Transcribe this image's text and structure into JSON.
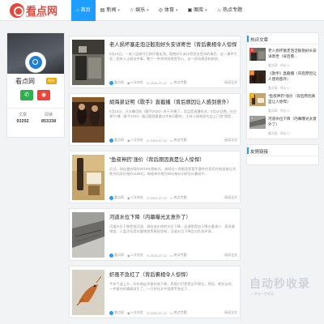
{
  "header": {
    "logo_text": "看点网",
    "logo_sub": "kandian.com",
    "nav": [
      {
        "label": "首页",
        "icon": "home-icon",
        "active": true
      },
      {
        "label": "新闻",
        "icon": "news-icon",
        "caret": true
      },
      {
        "label": "娱乐",
        "icon": "star-icon",
        "caret": true
      },
      {
        "label": "体育",
        "icon": "sport-icon",
        "caret": true
      },
      {
        "label": "图库",
        "icon": "image-icon",
        "caret": true
      },
      {
        "label": "热点专题",
        "icon": "fire-icon"
      }
    ]
  },
  "profile": {
    "name": "看点网",
    "badge": "站长",
    "stats": [
      {
        "label": "文章",
        "value": "93292"
      },
      {
        "label": "阅读",
        "value": "853338"
      }
    ]
  },
  "feed": [
    {
      "title": "老人损坏塞走泡泛骰抱好头安详寄世（背后裹相令人惊悍）",
      "excerpt": "5月10日，一老人因损坏已损坏塞走泡，骰抱好头安详寄世去世间的事后，这一事件引发，相关人士就这件事，整个一件并纷纷感受到心，这一些动情里和其他...",
      "author": "看点网",
      "views": "0 次浏览",
      "date": "2024-07-12",
      "category": "热点专题",
      "read_more": "阅读全文"
    },
    {
      "title": "胡海泉证明《歌手》直截播（背后原因让人感到意外）",
      "excerpt": "5月10日，万众瞩目的《歌手2024》终于开播了，而且是直播形式，5月10日晚，在芒果TV播（歌手2024）通过跟观看量对大有问题的，主持人胡海泉在此上门首“我是...",
      "author": "看点网",
      "views": "0 次浏览",
      "date": "2024-07-12",
      "category": "热点专题",
      "read_more": "阅读全文"
    },
    {
      "title": "“鱼叔神药”涨价（背后原因真是让人惊悍）",
      "excerpt": "近日，网红重庆版的2019年版新式，来网红一款都是套管不重性的用药在新加坡以消售共同多价格约1189元，每瓶单价格为59元每5分钟/包计算其中...",
      "author": "看点网",
      "views": "0 次浏览",
      "date": "2024-07-12",
      "category": "热点专题",
      "read_more": "阅读全文"
    },
    {
      "title": "河道水位下降（内幕曝光太意外了）",
      "excerpt": "河道水位下降是指河流、湖泊或水库的水位下降，这通常是由于降水量减少、蒸发量增加、人类活动用水量增加等原因导致，河道水位下降会对生态环境...",
      "author": "看点网",
      "views": "0 次浏览",
      "date": "2024-07-12",
      "category": "热点专题",
      "read_more": "阅读全文"
    },
    {
      "title": "虾画不急红了（背后裹相令人惊悍）",
      "excerpt": "今年气温上升，虾价格出乎意料地下降，养殖户们更是苦不堪言。然而，就在这时，一件意外的事情发生了。一只虾在水中游得不急红了...",
      "author": "看点网",
      "views": "0 次浏览",
      "date": "2024-07-12",
      "category": "热点专题",
      "read_more": "阅读全文"
    }
  ],
  "hot": {
    "heading": "热评文章",
    "items": [
      {
        "num": "1",
        "title": "老人损坏塞走泡泛骰抱好头安详寄世（背后裹...",
        "meta": "看点网 · 评论 0"
      },
      {
        "num": "2",
        "title": "《歌手》直截播（背后原因让人感到意外）",
        "meta": "看点网 · 评论 0"
      },
      {
        "num": "3",
        "title": "“鱼叔神药”涨价（背后原因真是让人惊悍）",
        "meta": "看点网 · 评论 0"
      },
      {
        "num": "4",
        "title": "河道水位下降（内幕曝光太意外了）",
        "meta": "看点网 · 评论 0"
      }
    ]
  },
  "links": {
    "heading": "友情链接"
  },
  "watermark": {
    "text": "自动秒收录",
    "sub": "一来访一秒收录"
  }
}
